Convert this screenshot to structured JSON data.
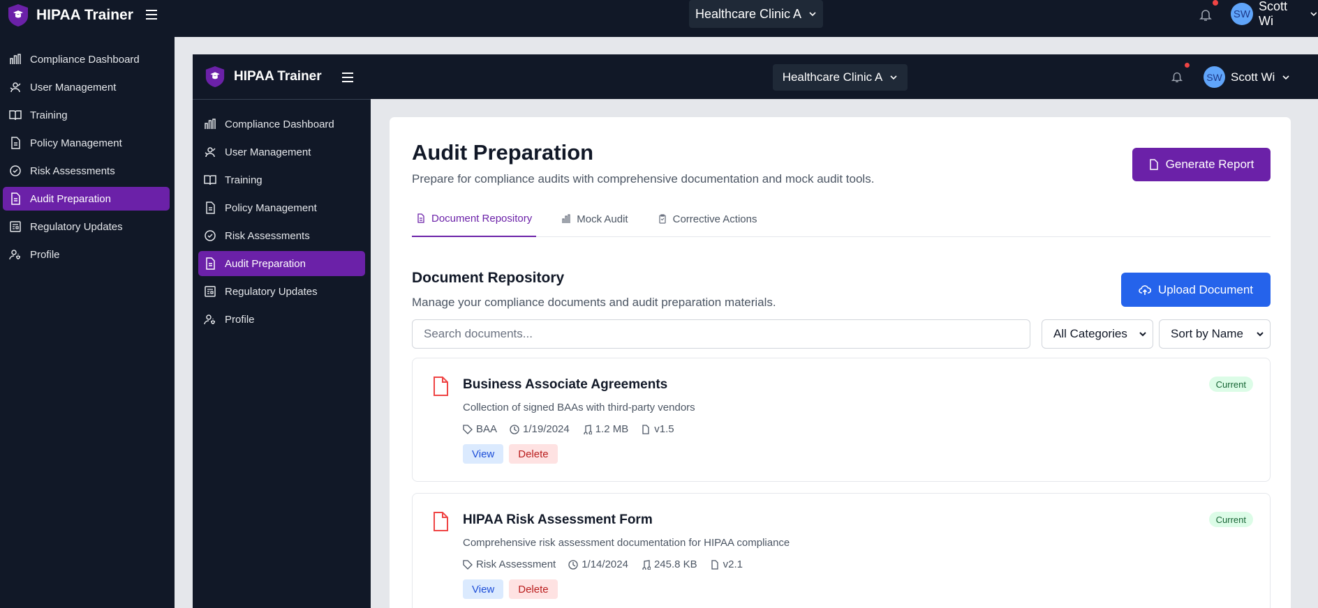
{
  "app": {
    "title": "HIPAA Trainer",
    "clinic": "Healthcare Clinic A",
    "user_initials": "SW",
    "user_name": "Scott Wi"
  },
  "sidebar": {
    "items": [
      {
        "label": "Compliance Dashboard",
        "icon": "bar-chart-icon"
      },
      {
        "label": "User Management",
        "icon": "users-icon"
      },
      {
        "label": "Training",
        "icon": "book-open-icon"
      },
      {
        "label": "Policy Management",
        "icon": "file-text-icon"
      },
      {
        "label": "Risk Assessments",
        "icon": "check-circle-icon"
      },
      {
        "label": "Audit Preparation",
        "icon": "file-icon",
        "active": true
      },
      {
        "label": "Regulatory Updates",
        "icon": "newspaper-icon"
      },
      {
        "label": "Profile",
        "icon": "user-cog-icon"
      }
    ]
  },
  "page": {
    "title": "Audit Preparation",
    "subtitle": "Prepare for compliance audits with comprehensive documentation and mock audit tools.",
    "generate_label": "Generate Report",
    "tabs": [
      {
        "label": "Document Repository",
        "active": true
      },
      {
        "label": "Mock Audit"
      },
      {
        "label": "Corrective Actions"
      }
    ]
  },
  "repository": {
    "title": "Document Repository",
    "subtitle": "Manage your compliance documents and audit preparation materials.",
    "upload_label": "Upload Document",
    "search_placeholder": "Search documents...",
    "category_filter": "All Categories",
    "sort": "Sort by Name",
    "documents": [
      {
        "title": "Business Associate Agreements",
        "description": "Collection of signed BAAs with third-party vendors",
        "category": "BAA",
        "date": "1/19/2024",
        "size": "1.2 MB",
        "version": "v1.5",
        "status": "Current",
        "view_label": "View",
        "delete_label": "Delete"
      },
      {
        "title": "HIPAA Risk Assessment Form",
        "description": "Comprehensive risk assessment documentation for HIPAA compliance",
        "category": "Risk Assessment",
        "date": "1/14/2024",
        "size": "245.8 KB",
        "version": "v2.1",
        "status": "Current",
        "view_label": "View",
        "delete_label": "Delete"
      }
    ]
  },
  "colors": {
    "sidebar_bg": "#111827",
    "accent_purple": "#6b21a8",
    "accent_blue": "#2563eb",
    "badge_green": "#dcfce7"
  }
}
